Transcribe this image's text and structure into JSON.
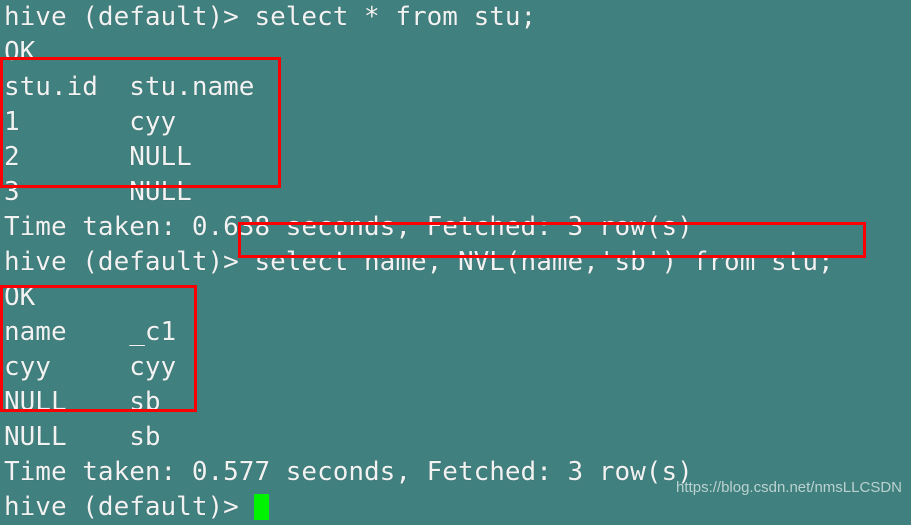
{
  "terminal": {
    "background_color": "#40807e",
    "text_color": "#f2f2f2",
    "annotation_color": "#fa0000",
    "cursor_color": "#00f300",
    "lines": [
      {
        "text": "hive (default)> select * from stu;"
      },
      {
        "text": "OK"
      },
      {
        "text": "stu.id  stu.name"
      },
      {
        "text": "1       cyy"
      },
      {
        "text": "2       NULL"
      },
      {
        "text": "3       NULL"
      },
      {
        "text": "Time taken: 0.638 seconds, Fetched: 3 row(s)"
      },
      {
        "text": "hive (default)> select name, NVL(name,'sb') from stu;"
      },
      {
        "text": "OK"
      },
      {
        "text": "name    _c1"
      },
      {
        "text": "cyy     cyy"
      },
      {
        "text": "NULL    sb"
      },
      {
        "text": "NULL    sb"
      },
      {
        "text": "Time taken: 0.577 seconds, Fetched: 3 row(s)"
      }
    ],
    "prompt_final": "hive (default)> "
  },
  "queries": {
    "first": "select * from stu;",
    "second": "select name, NVL(name,'sb') from stu;",
    "prompt": "hive (default)>"
  },
  "result_table_1": {
    "headers": [
      "stu.id",
      "stu.name"
    ],
    "rows": [
      [
        "1",
        "cyy"
      ],
      [
        "2",
        "NULL"
      ],
      [
        "3",
        "NULL"
      ]
    ],
    "status": "OK",
    "footer": "Time taken: 0.638 seconds, Fetched: 3 row(s)",
    "time_taken_seconds": "0.638",
    "fetched_rows": "3"
  },
  "result_table_2": {
    "headers": [
      "name",
      "_c1"
    ],
    "rows": [
      [
        "cyy",
        "cyy"
      ],
      [
        "NULL",
        "sb"
      ],
      [
        "NULL",
        "sb"
      ]
    ],
    "status": "OK",
    "footer": "Time taken: 0.577 seconds, Fetched: 3 row(s)",
    "time_taken_seconds": "0.577",
    "fetched_rows": "3"
  },
  "watermark": {
    "text": "https://blog.csdn.net/nmsLLCSDN"
  }
}
